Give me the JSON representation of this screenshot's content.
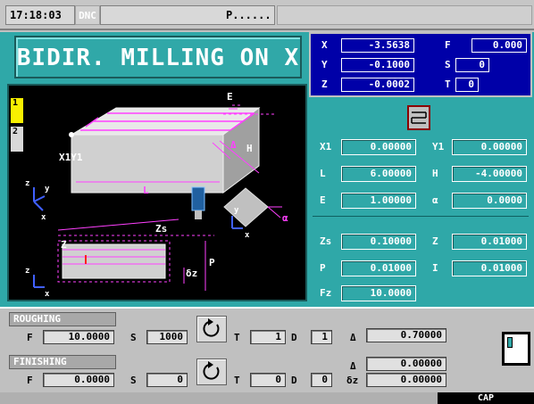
{
  "topbar": {
    "time": "17:18:03",
    "mode": "DNC",
    "program": "P......"
  },
  "title": "BIDIR. MILLING ON X",
  "tabs": [
    "1",
    "2"
  ],
  "coords": {
    "x_label": "X",
    "x": "-3.5638",
    "y_label": "Y",
    "y": "-0.1000",
    "z_label": "Z",
    "z": "-0.0002",
    "f_label": "F",
    "f": "0.000",
    "s_label": "S",
    "s": "0",
    "t_label": "T",
    "t": "0"
  },
  "drawing_labels": {
    "e": "E",
    "delta": "Δ",
    "h": "H",
    "x1y1": "X1Y1",
    "l": "L",
    "alpha": "α",
    "zs": "Zs",
    "z": "Z",
    "p": "P",
    "dz": "δz",
    "axis_z": "z",
    "axis_y": "y",
    "axis_x": "x"
  },
  "params": {
    "x1_label": "X1",
    "x1": "0.00000",
    "y1_label": "Y1",
    "y1": "0.00000",
    "l_label": "L",
    "l": "6.00000",
    "h_label": "H",
    "h": "-4.00000",
    "e_label": "E",
    "e": "1.00000",
    "a_label": "α",
    "a": "0.0000",
    "zs_label": "Zs",
    "zs": "0.10000",
    "z_label": "Z",
    "z": "0.01000",
    "p_label": "P",
    "p": "0.01000",
    "i_label": "I",
    "i": "0.01000",
    "fz_label": "Fz",
    "fz": "10.0000"
  },
  "roughing": {
    "title": "ROUGHING",
    "f_label": "F",
    "f": "10.0000",
    "s_label": "S",
    "s": "1000",
    "t_label": "T",
    "t": "1",
    "d_label": "D",
    "d": "1",
    "delta_label": "Δ",
    "delta": "0.70000"
  },
  "finishing": {
    "title": "FINISHING",
    "f_label": "F",
    "f": "0.0000",
    "s_label": "S",
    "s": "0",
    "t_label": "T",
    "t": "0",
    "d_label": "D",
    "d": "0",
    "delta_label": "Δ",
    "delta": "0.00000",
    "dz_label": "δz",
    "dz": "0.00000"
  },
  "status": {
    "cap": "CAP"
  }
}
